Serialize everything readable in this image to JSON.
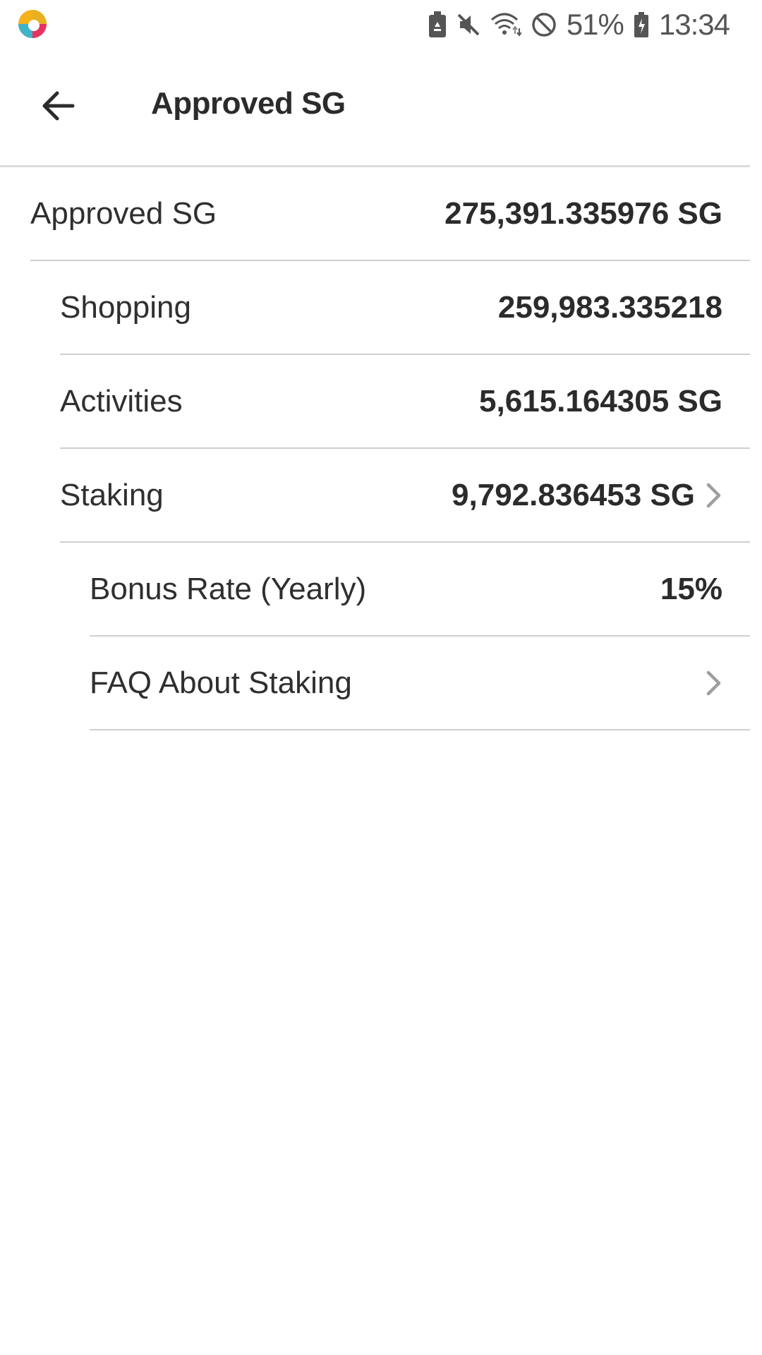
{
  "status_bar": {
    "battery_percent": "51%",
    "time": "13:34",
    "icons": [
      "app-logo-icon",
      "battery-saver-icon",
      "mute-icon",
      "wifi-icon",
      "do-not-disturb-icon",
      "battery-charging-icon"
    ]
  },
  "app_bar": {
    "title": "Approved SG",
    "back_icon": "arrow-left-icon"
  },
  "rows": [
    {
      "label": "Approved SG",
      "value": "275,391.335976 SG"
    },
    {
      "label": "Shopping",
      "value": "259,983.335218"
    },
    {
      "label": "Activities",
      "value": "5,615.164305 SG"
    },
    {
      "label": "Staking",
      "value": "9,792.836453 SG"
    },
    {
      "label": "Bonus Rate (Yearly)",
      "value": "15%"
    },
    {
      "label": "FAQ About Staking",
      "value": ""
    }
  ],
  "colors": {
    "text": "#2b2b2b",
    "divider": "#cfcfcf",
    "chevron": "#9e9e9e",
    "background": "#ffffff"
  }
}
